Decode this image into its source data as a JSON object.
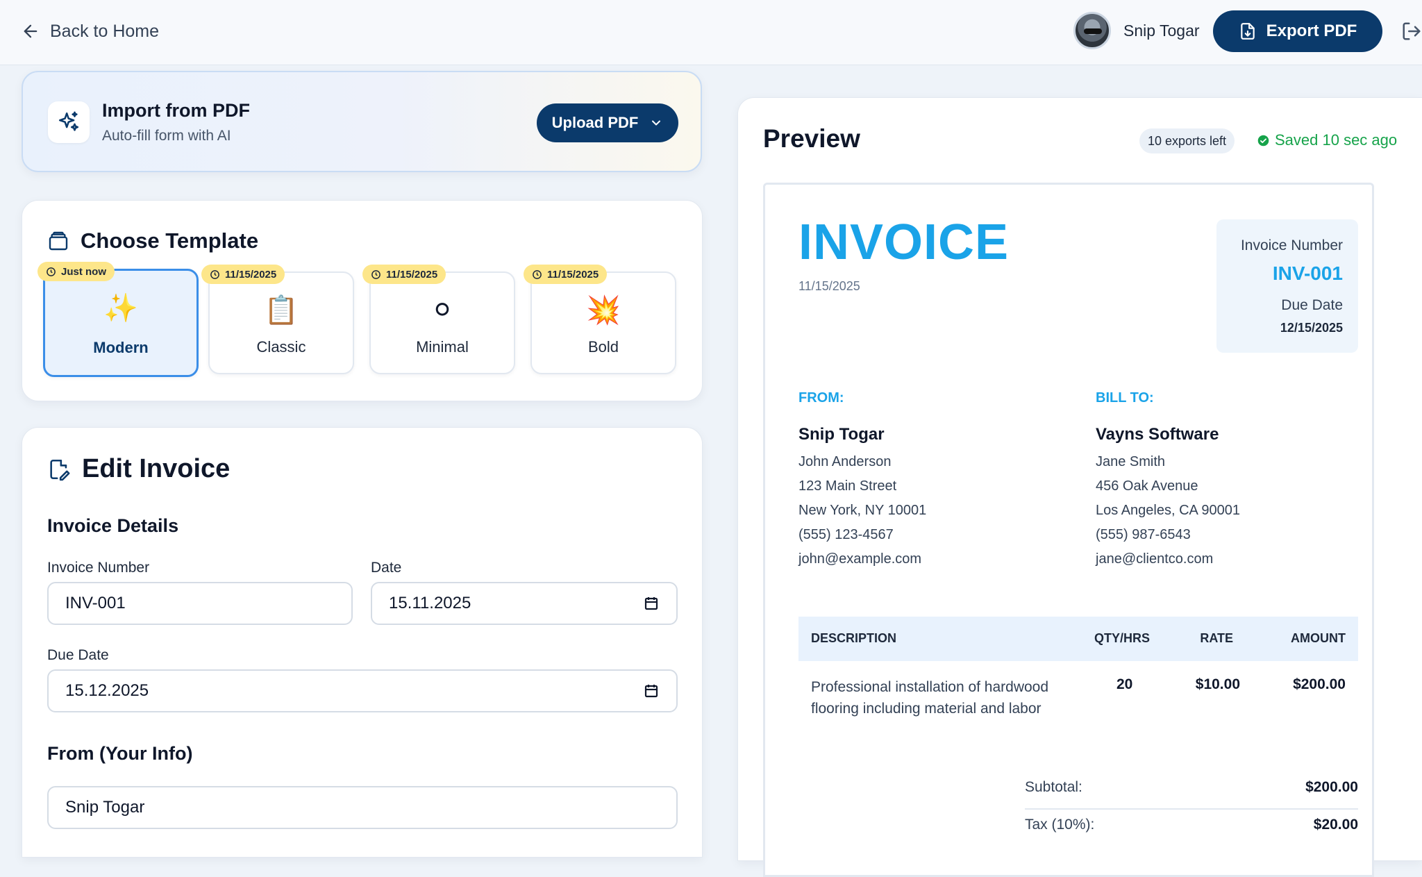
{
  "header": {
    "back_label": "Back to Home",
    "user_name": "Snip Togar",
    "export_label": "Export PDF"
  },
  "import": {
    "title": "Import from PDF",
    "subtitle": "Auto-fill form with AI",
    "upload_label": "Upload PDF"
  },
  "templates": {
    "heading": "Choose Template",
    "items": [
      {
        "name": "Modern",
        "badge": "Just now",
        "emoji": "✨",
        "selected": true
      },
      {
        "name": "Classic",
        "badge": "11/15/2025",
        "emoji": "📋",
        "selected": false
      },
      {
        "name": "Minimal",
        "badge": "11/15/2025",
        "emoji": "⚪",
        "selected": false
      },
      {
        "name": "Bold",
        "badge": "11/15/2025",
        "emoji": "💥",
        "selected": false
      }
    ]
  },
  "edit": {
    "heading": "Edit Invoice",
    "details_title": "Invoice Details",
    "invoice_number_label": "Invoice Number",
    "invoice_number_value": "INV-001",
    "date_label": "Date",
    "date_value": "15.11.2025",
    "due_date_label": "Due Date",
    "due_date_value": "15.12.2025",
    "from_title": "From (Your Info)",
    "from_name_value": "Snip Togar"
  },
  "preview": {
    "title": "Preview",
    "exports_left": "10 exports left",
    "saved_status": "Saved 10 sec ago",
    "accent_color": "#1aa3e8",
    "invoice": {
      "title": "INVOICE",
      "date": "11/15/2025",
      "number_label": "Invoice Number",
      "number": "INV-001",
      "due_label": "Due Date",
      "due_date": "12/15/2025",
      "from": {
        "title": "FROM:",
        "name": "Snip Togar",
        "lines": [
          "John Anderson",
          "123 Main Street",
          "New York, NY 10001",
          "(555) 123-4567",
          "john@example.com"
        ]
      },
      "bill_to": {
        "title": "BILL TO:",
        "name": "Vayns Software",
        "lines": [
          "Jane Smith",
          "456 Oak Avenue",
          "Los Angeles, CA 90001",
          "(555) 987-6543",
          "jane@clientco.com"
        ]
      },
      "columns": [
        "DESCRIPTION",
        "QTY/HRS",
        "RATE",
        "AMOUNT"
      ],
      "items": [
        {
          "description": "Professional installation of hardwood flooring including material and labor",
          "qty": "20",
          "rate": "$10.00",
          "amount": "$200.00"
        }
      ],
      "subtotal_label": "Subtotal:",
      "subtotal": "$200.00",
      "tax_label": "Tax (10%):",
      "tax": "$20.00"
    }
  }
}
